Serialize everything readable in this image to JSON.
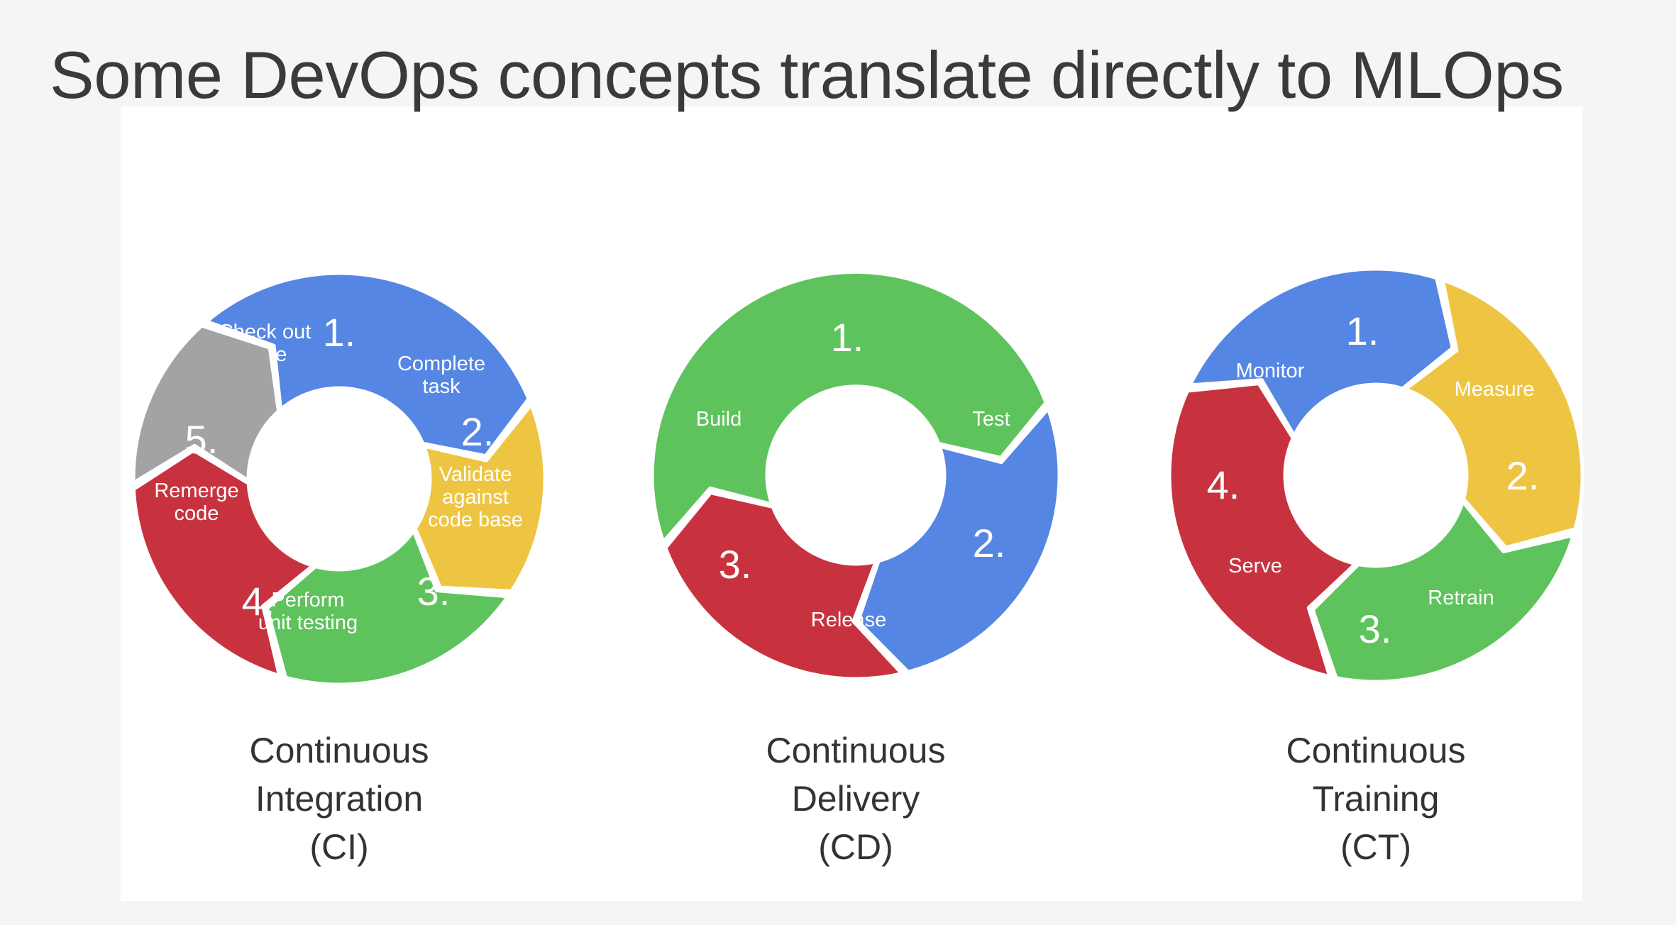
{
  "title": "Some DevOps concepts translate directly to MLOps",
  "colors": {
    "blue": "#5586e3",
    "yellow": "#eec542",
    "green": "#5ec35c",
    "red": "#c8323f",
    "gray": "#a3a3a6",
    "background": "#f5f5f5",
    "panel": "#ffffff"
  },
  "cycles": [
    {
      "id": "ci",
      "caption": [
        "Continuous",
        "Integration",
        "(CI)"
      ],
      "segments": [
        {
          "num": "1.",
          "label": [
            "Check out",
            "code"
          ],
          "color": "blue"
        },
        {
          "num": "2.",
          "label": [
            "Complete",
            "task"
          ],
          "color": "yellow"
        },
        {
          "num": "3.",
          "label": [
            "Validate",
            "against",
            "code base"
          ],
          "color": "green"
        },
        {
          "num": "4.",
          "label": [
            "Perform",
            "unit testing"
          ],
          "color": "red"
        },
        {
          "num": "5.",
          "label": [
            "Remerge",
            "code"
          ],
          "color": "gray"
        }
      ]
    },
    {
      "id": "cd",
      "caption": [
        "Continuous",
        "Delivery",
        "(CD)"
      ],
      "segments": [
        {
          "num": "1.",
          "label": [
            "Build"
          ],
          "color": "green"
        },
        {
          "num": "2.",
          "label": [
            "Test"
          ],
          "color": "blue"
        },
        {
          "num": "3.",
          "label": [
            "Release"
          ],
          "color": "red"
        }
      ]
    },
    {
      "id": "ct",
      "caption": [
        "Continuous",
        "Training",
        "(CT)"
      ],
      "segments": [
        {
          "num": "1.",
          "label": [
            "Monitor"
          ],
          "color": "blue"
        },
        {
          "num": "2.",
          "label": [
            "Measure"
          ],
          "color": "yellow"
        },
        {
          "num": "3.",
          "label": [
            "Retrain"
          ],
          "color": "green"
        },
        {
          "num": "4.",
          "label": [
            "Serve"
          ],
          "color": "red"
        }
      ]
    }
  ]
}
